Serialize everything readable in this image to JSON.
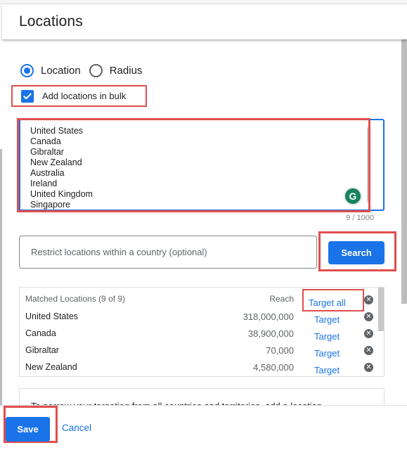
{
  "header": {
    "title": "Locations"
  },
  "targeting_mode": {
    "options": [
      {
        "label": "Location",
        "checked": true
      },
      {
        "label": "Radius",
        "checked": false
      }
    ]
  },
  "bulk": {
    "checkbox_label": "Add locations in bulk",
    "checked": true,
    "textarea_value": "United States\nCanada\nGibraltar\nNew Zealand\nAustralia\nIreland\nUnited Kingdom\nSingapore",
    "char_count": "9 / 1000",
    "grammarly_icon": "G"
  },
  "restrict": {
    "placeholder": "Restrict locations within a country (optional)",
    "search_label": "Search"
  },
  "results": {
    "header": "Matched Locations (9 of 9)",
    "reach_header": "Reach",
    "target_all_label": "Target all",
    "remove_glyph": "✕",
    "rows": [
      {
        "name": "United States",
        "reach": "318,000,000",
        "action": "Target"
      },
      {
        "name": "Canada",
        "reach": "38,900,000",
        "action": "Target"
      },
      {
        "name": "Gibraltar",
        "reach": "70,000",
        "action": "Target"
      },
      {
        "name": "New Zealand",
        "reach": "4,580,000",
        "action": "Target"
      }
    ]
  },
  "info": {
    "text": "To narrow your targeting from all countries and territories, add a location."
  },
  "footer": {
    "save_label": "Save",
    "cancel_label": "Cancel"
  },
  "colors": {
    "accent": "#1a73e8",
    "highlight": "#e04e4e",
    "grammarly": "#15845f"
  }
}
